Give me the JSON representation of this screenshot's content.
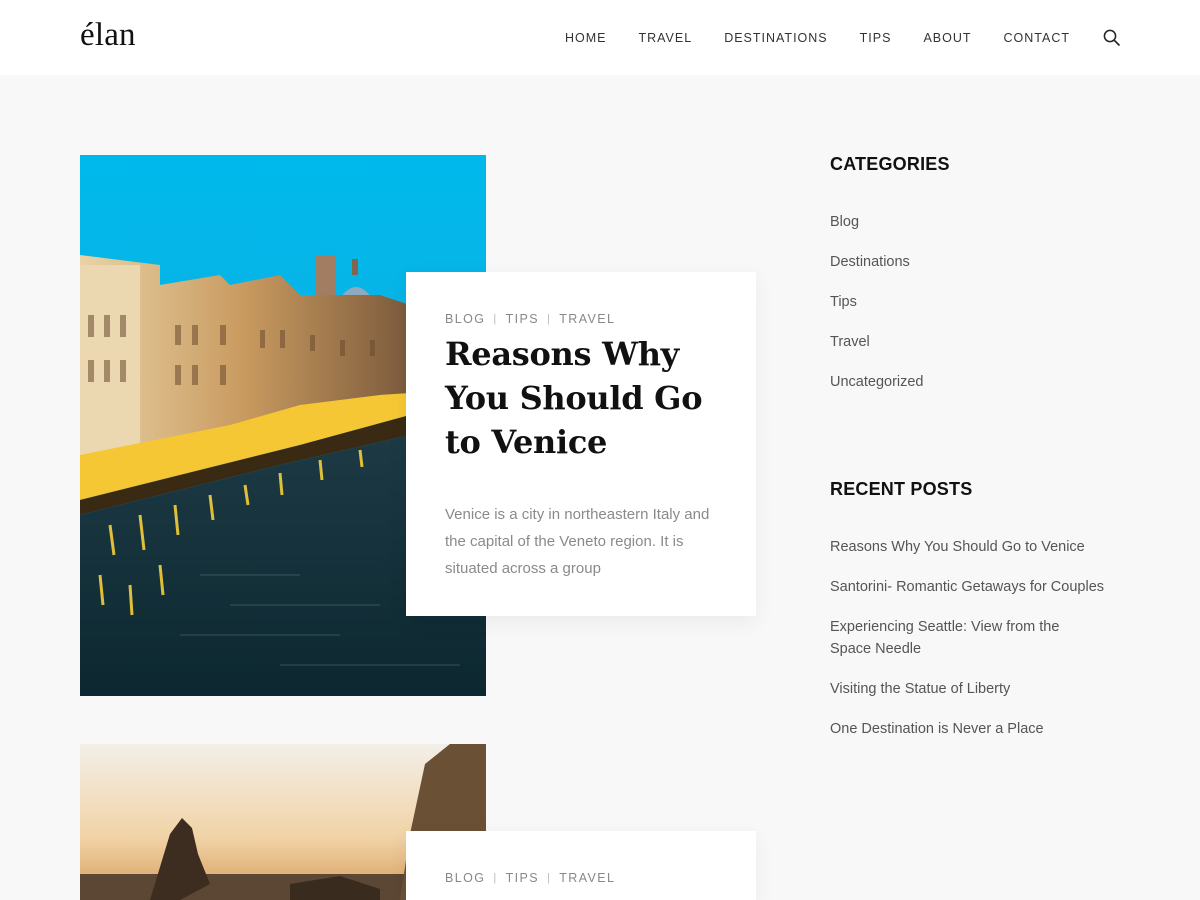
{
  "header": {
    "logo": "élan",
    "nav": [
      "HOME",
      "TRAVEL",
      "DESTINATIONS",
      "TIPS",
      "ABOUT",
      "CONTACT"
    ],
    "search_icon": "search-icon"
  },
  "posts": [
    {
      "categories": [
        "BLOG",
        "TIPS",
        "TRAVEL"
      ],
      "title": "Reasons Why You Should Go to Venice",
      "excerpt": "Venice is a city in northeastern Italy and the capital of the Veneto region. It is situated across a group"
    },
    {
      "categories": [
        "BLOG",
        "TIPS",
        "TRAVEL"
      ]
    }
  ],
  "sidebar": {
    "categories_title": "CATEGORIES",
    "categories": [
      "Blog",
      "Destinations",
      "Tips",
      "Travel",
      "Uncategorized"
    ],
    "recent_title": "RECENT POSTS",
    "recent": [
      "Reasons Why You Should Go to Venice",
      "Santorini- Romantic Getaways for Couples",
      "Experiencing Seattle: View from the Space Needle",
      "Visiting the Statue of Liberty",
      "One Destination is Never a Place"
    ]
  },
  "colors": {
    "background": "#f8f8f8",
    "header": "#ffffff",
    "text": "#111111",
    "muted": "#888888"
  }
}
